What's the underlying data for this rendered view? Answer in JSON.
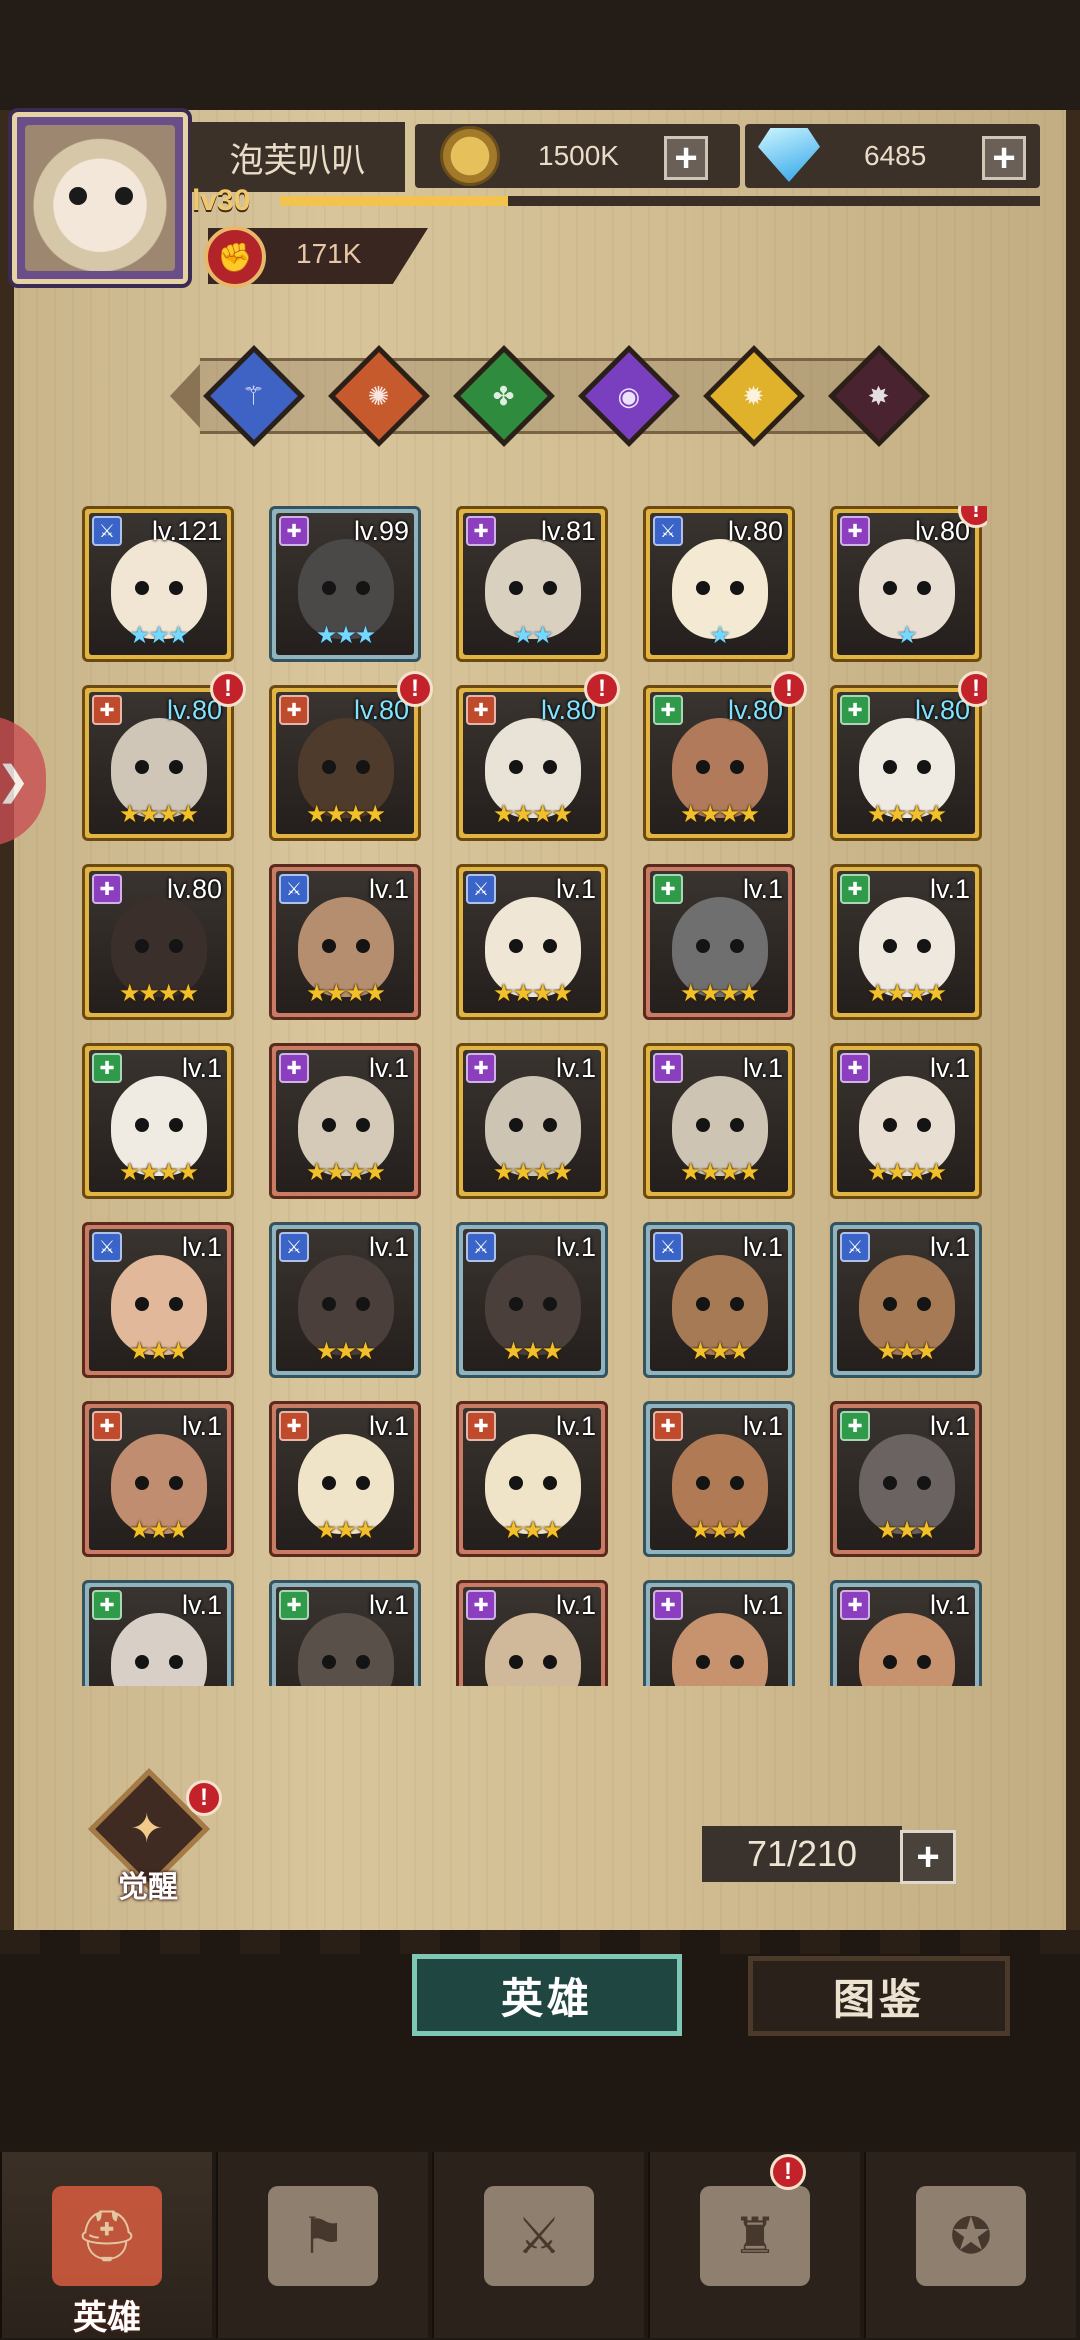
{
  "player": {
    "name": "泡芙叭叭",
    "level_label": "lv30",
    "xp_fraction": 0.3,
    "power": "171K"
  },
  "resources": {
    "coins": "1500K",
    "gems": "6485"
  },
  "faction_filters": [
    {
      "name": "faction-light",
      "color": "#3f63c4"
    },
    {
      "name": "faction-fire",
      "color": "#c75a2d"
    },
    {
      "name": "faction-nature",
      "color": "#2f8b3e"
    },
    {
      "name": "faction-arcane",
      "color": "#7a3fbf"
    },
    {
      "name": "faction-sun",
      "color": "#e0b12a"
    },
    {
      "name": "faction-dark",
      "color": "#4a2330"
    }
  ],
  "heroes": [
    {
      "level": "lv.121",
      "stars": "★★★",
      "frame": "gold",
      "class_color": "#3b64c8",
      "skin": "#f1e6d4",
      "level_cyan": false,
      "stars_cyan": true,
      "alert": false
    },
    {
      "level": "lv.99",
      "stars": "★★★",
      "frame": "blue",
      "class_color": "#8b3fbf",
      "skin": "#4b4848",
      "level_cyan": false,
      "stars_cyan": true,
      "alert": false
    },
    {
      "level": "lv.81",
      "stars": "★★",
      "frame": "gold",
      "class_color": "#8b3fbf",
      "skin": "#d9d0c0",
      "level_cyan": false,
      "stars_cyan": true,
      "alert": false
    },
    {
      "level": "lv.80",
      "stars": "★",
      "frame": "gold",
      "class_color": "#3b64c8",
      "skin": "#f4ead3",
      "level_cyan": false,
      "stars_cyan": true,
      "alert": false
    },
    {
      "level": "lv.80",
      "stars": "★",
      "frame": "gold",
      "class_color": "#8b3fbf",
      "skin": "#e8dfd2",
      "level_cyan": false,
      "stars_cyan": true,
      "alert": true
    },
    {
      "level": "lv.80",
      "stars": "★★★★",
      "frame": "gold",
      "class_color": "#c04a2c",
      "skin": "#cfc6b8",
      "level_cyan": true,
      "stars_cyan": false,
      "alert": true
    },
    {
      "level": "lv.80",
      "stars": "★★★★",
      "frame": "gold",
      "class_color": "#c04a2c",
      "skin": "#4e3b2c",
      "level_cyan": true,
      "stars_cyan": false,
      "alert": true
    },
    {
      "level": "lv.80",
      "stars": "★★★★",
      "frame": "gold",
      "class_color": "#c04a2c",
      "skin": "#e9e2d6",
      "level_cyan": true,
      "stars_cyan": false,
      "alert": true
    },
    {
      "level": "lv.80",
      "stars": "★★★★",
      "frame": "gold",
      "class_color": "#2f9a4a",
      "skin": "#b07a5b",
      "level_cyan": true,
      "stars_cyan": false,
      "alert": true
    },
    {
      "level": "lv.80",
      "stars": "★★★★",
      "frame": "gold",
      "class_color": "#2f9a4a",
      "skin": "#f0ebe2",
      "level_cyan": true,
      "stars_cyan": false,
      "alert": true
    },
    {
      "level": "lv.80",
      "stars": "★★★★",
      "frame": "gold",
      "class_color": "#8b3fbf",
      "skin": "#3b2f2b",
      "level_cyan": false,
      "stars_cyan": false,
      "alert": false
    },
    {
      "level": "lv.1",
      "stars": "★★★★",
      "frame": "red",
      "class_color": "#3b64c8",
      "skin": "#b58e70",
      "level_cyan": false,
      "stars_cyan": false,
      "alert": false
    },
    {
      "level": "lv.1",
      "stars": "★★★★",
      "frame": "gold",
      "class_color": "#3b64c8",
      "skin": "#efe6d6",
      "level_cyan": false,
      "stars_cyan": false,
      "alert": false
    },
    {
      "level": "lv.1",
      "stars": "★★★★",
      "frame": "red",
      "class_color": "#2f9a4a",
      "skin": "#6f6f6f",
      "level_cyan": false,
      "stars_cyan": false,
      "alert": false
    },
    {
      "level": "lv.1",
      "stars": "★★★★",
      "frame": "gold",
      "class_color": "#2f9a4a",
      "skin": "#eee8de",
      "level_cyan": false,
      "stars_cyan": false,
      "alert": false
    },
    {
      "level": "lv.1",
      "stars": "★★★★",
      "frame": "gold",
      "class_color": "#2f9a4a",
      "skin": "#f0ebe2",
      "level_cyan": false,
      "stars_cyan": false,
      "alert": false
    },
    {
      "level": "lv.1",
      "stars": "★★★★",
      "frame": "red",
      "class_color": "#8b3fbf",
      "skin": "#d4cab7",
      "level_cyan": false,
      "stars_cyan": false,
      "alert": false
    },
    {
      "level": "lv.1",
      "stars": "★★★★",
      "frame": "gold",
      "class_color": "#8b3fbf",
      "skin": "#cdc4b3",
      "level_cyan": false,
      "stars_cyan": false,
      "alert": false
    },
    {
      "level": "lv.1",
      "stars": "★★★★",
      "frame": "gold",
      "class_color": "#8b3fbf",
      "skin": "#cdc4b3",
      "level_cyan": false,
      "stars_cyan": false,
      "alert": false
    },
    {
      "level": "lv.1",
      "stars": "★★★★",
      "frame": "gold",
      "class_color": "#8b3fbf",
      "skin": "#e8dfd2",
      "level_cyan": false,
      "stars_cyan": false,
      "alert": false
    },
    {
      "level": "lv.1",
      "stars": "★★★",
      "frame": "red",
      "class_color": "#3b64c8",
      "skin": "#e2b89a",
      "level_cyan": false,
      "stars_cyan": false,
      "alert": false
    },
    {
      "level": "lv.1",
      "stars": "★★★",
      "frame": "blue",
      "class_color": "#3b64c8",
      "skin": "#4a3f3b",
      "level_cyan": false,
      "stars_cyan": false,
      "alert": false
    },
    {
      "level": "lv.1",
      "stars": "★★★",
      "frame": "blue",
      "class_color": "#3b64c8",
      "skin": "#4a3f3b",
      "level_cyan": false,
      "stars_cyan": false,
      "alert": false
    },
    {
      "level": "lv.1",
      "stars": "★★★",
      "frame": "blue",
      "class_color": "#3b64c8",
      "skin": "#a57a55",
      "level_cyan": false,
      "stars_cyan": false,
      "alert": false
    },
    {
      "level": "lv.1",
      "stars": "★★★",
      "frame": "blue",
      "class_color": "#3b64c8",
      "skin": "#a57a55",
      "level_cyan": false,
      "stars_cyan": false,
      "alert": false
    },
    {
      "level": "lv.1",
      "stars": "★★★",
      "frame": "red",
      "class_color": "#c04a2c",
      "skin": "#c08d70",
      "level_cyan": false,
      "stars_cyan": false,
      "alert": false
    },
    {
      "level": "lv.1",
      "stars": "★★★",
      "frame": "red",
      "class_color": "#c04a2c",
      "skin": "#efe3c8",
      "level_cyan": false,
      "stars_cyan": false,
      "alert": false
    },
    {
      "level": "lv.1",
      "stars": "★★★",
      "frame": "red",
      "class_color": "#c04a2c",
      "skin": "#efe3c8",
      "level_cyan": false,
      "stars_cyan": false,
      "alert": false
    },
    {
      "level": "lv.1",
      "stars": "★★★",
      "frame": "blue",
      "class_color": "#c04a2c",
      "skin": "#b07a55",
      "level_cyan": false,
      "stars_cyan": false,
      "alert": false
    },
    {
      "level": "lv.1",
      "stars": "★★★",
      "frame": "red",
      "class_color": "#2f9a4a",
      "skin": "#6b6262",
      "level_cyan": false,
      "stars_cyan": false,
      "alert": false
    },
    {
      "level": "lv.1",
      "stars": "",
      "frame": "blue",
      "class_color": "#2f9a4a",
      "skin": "#d8d0c6",
      "level_cyan": false,
      "stars_cyan": false,
      "alert": false
    },
    {
      "level": "lv.1",
      "stars": "",
      "frame": "blue",
      "class_color": "#2f9a4a",
      "skin": "#5a504a",
      "level_cyan": false,
      "stars_cyan": false,
      "alert": false
    },
    {
      "level": "lv.1",
      "stars": "",
      "frame": "red",
      "class_color": "#8b3fbf",
      "skin": "#d0b89a",
      "level_cyan": false,
      "stars_cyan": false,
      "alert": false
    },
    {
      "level": "lv.1",
      "stars": "",
      "frame": "blue",
      "class_color": "#8b3fbf",
      "skin": "#c7926e",
      "level_cyan": false,
      "stars_cyan": false,
      "alert": false
    },
    {
      "level": "lv.1",
      "stars": "",
      "frame": "blue",
      "class_color": "#8b3fbf",
      "skin": "#c7926e",
      "level_cyan": false,
      "stars_cyan": false,
      "alert": false
    }
  ],
  "awaken_label": "觉醒",
  "alert_mark": "!",
  "plus_sign": "+",
  "hero_count": "71/210",
  "tabs": {
    "heroes": "英雄",
    "codex": "图鉴"
  },
  "nav": [
    {
      "label": "英雄",
      "icon": "helmet-icon",
      "active": true,
      "alert": false
    },
    {
      "label": "",
      "icon": "flag-icon",
      "active": false,
      "alert": false
    },
    {
      "label": "",
      "icon": "crossed-swords-icon",
      "active": false,
      "alert": false
    },
    {
      "label": "",
      "icon": "castle-icon",
      "active": false,
      "alert": true
    },
    {
      "label": "",
      "icon": "guild-crest-icon",
      "active": false,
      "alert": false
    }
  ]
}
